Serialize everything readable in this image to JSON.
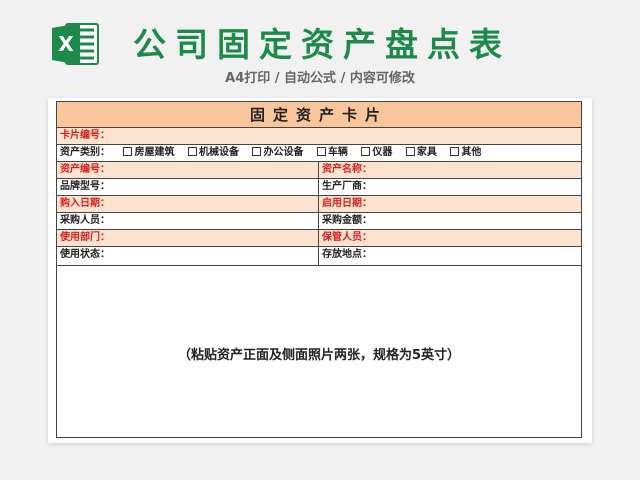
{
  "header": {
    "title": "公司固定资产盘点表",
    "subtitle": "A4打印 / 自动公式 / 内容可修改",
    "logo_icon": "excel-icon",
    "brand_color": "#1d8a4a"
  },
  "card": {
    "title": "固定资产卡片",
    "card_no_label": "卡片编号：",
    "category": {
      "label": "资产类别：",
      "options": [
        "房屋建筑",
        "机械设备",
        "办公设备",
        "车辆",
        "仪器",
        "家具",
        "其他"
      ]
    },
    "asset_no_label": "资产编号：",
    "asset_name_label": "资产名称：",
    "model_label": "品牌型号：",
    "maker_label": "生产厂商：",
    "purchase_date_label": "购入日期：",
    "start_date_label": "启用日期：",
    "buyer_label": "采购人员：",
    "amount_label": "采购金额：",
    "dept_label": "使用部门：",
    "keeper_label": "保管人员：",
    "status_label": "使用状态：",
    "location_label": "存放地点：",
    "photo_note": "（粘贴资产正面及侧面照片两张，规格为5英寸）"
  },
  "colors": {
    "title_bar": "#f9c59a",
    "row_highlight": "#fce3d0",
    "red_label": "#d81e1e"
  }
}
